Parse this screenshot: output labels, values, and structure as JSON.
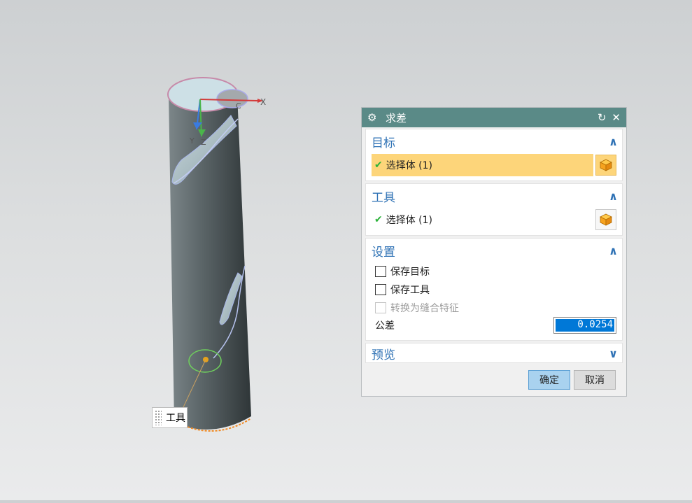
{
  "viewport": {
    "axis_x_label": "X",
    "axis_y_label": "Y",
    "axis_z_label": "Z",
    "csys_label": "C",
    "tool_tag_label": "工具"
  },
  "dialog": {
    "title": "求差",
    "icons": {
      "title": "gear-icon",
      "reset": "reset-icon",
      "close": "close-icon"
    },
    "target": {
      "header": "目标",
      "select_label": "选择体 (1)"
    },
    "tool": {
      "header": "工具",
      "select_label": "选择体 (1)"
    },
    "settings": {
      "header": "设置",
      "keep_target_label": "保存目标",
      "keep_tool_label": "保存工具",
      "convert_label": "转换为缝合特征",
      "tolerance_label": "公差",
      "tolerance_value": "0.0254"
    },
    "preview": {
      "header": "预览"
    },
    "ok_label": "确定",
    "cancel_label": "取消"
  },
  "colors": {
    "titlebar": "#5a8a87",
    "header_text": "#2f72b5",
    "active_selection": "#fdd57a",
    "check": "#2bb239",
    "ok_button": "#a9d2ef"
  }
}
